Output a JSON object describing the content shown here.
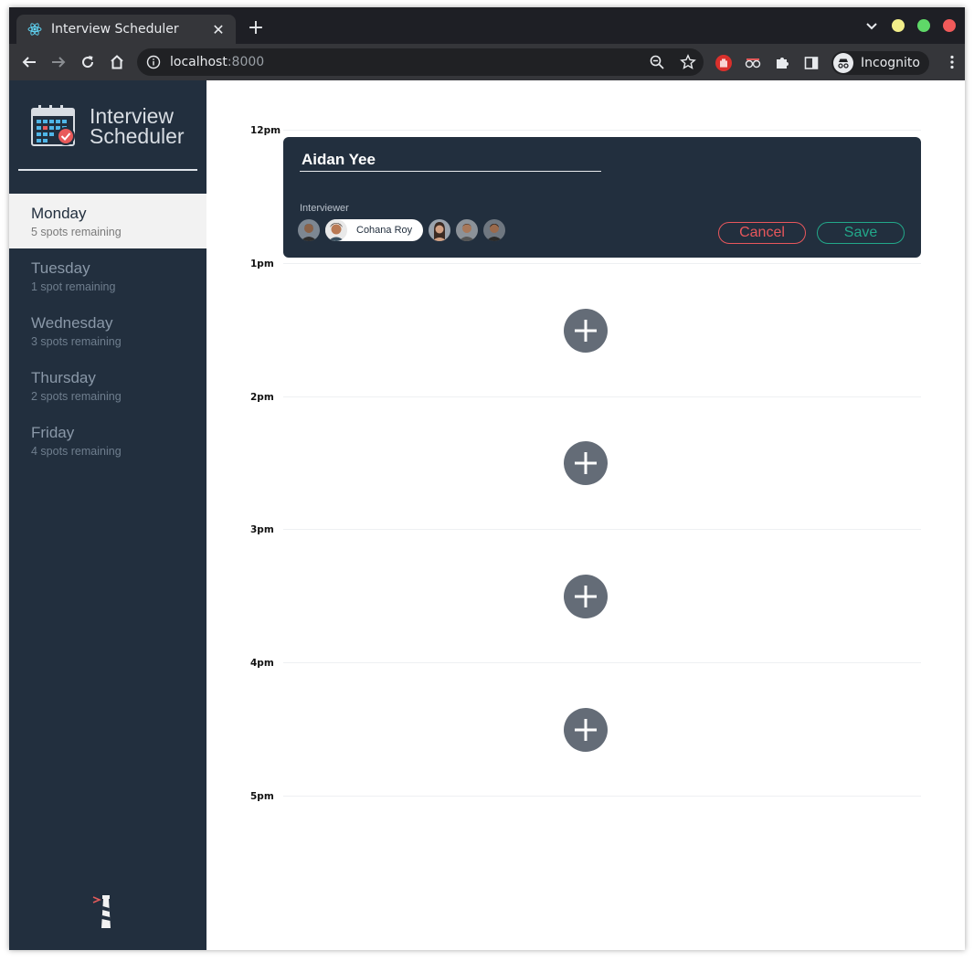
{
  "browser": {
    "tab_title": "Interview Scheduler",
    "tab_close": "✕",
    "new_tab": "+",
    "url_host": "localhost",
    "url_port": ":8000",
    "incognito_label": "Incognito"
  },
  "sidebar": {
    "logo_line1": "Interview",
    "logo_line2": "Scheduler",
    "days": [
      {
        "name": "Monday",
        "spots": "5 spots remaining",
        "selected": true
      },
      {
        "name": "Tuesday",
        "spots": "1 spot remaining",
        "selected": false
      },
      {
        "name": "Wednesday",
        "spots": "3 spots remaining",
        "selected": false
      },
      {
        "name": "Thursday",
        "spots": "2 spots remaining",
        "selected": false
      },
      {
        "name": "Friday",
        "spots": "4 spots remaining",
        "selected": false
      }
    ]
  },
  "schedule": {
    "times": [
      "12pm",
      "1pm",
      "2pm",
      "3pm",
      "4pm",
      "5pm"
    ],
    "form": {
      "student_name": "Aidan Yee",
      "interviewer_label": "Interviewer",
      "selected_interviewer": "Cohana Roy",
      "cancel_label": "Cancel",
      "save_label": "Save"
    }
  },
  "colors": {
    "sidebar_bg": "#222f3e",
    "cancel": "#e8575c",
    "save": "#22a88a",
    "add_button": "#646c77"
  }
}
